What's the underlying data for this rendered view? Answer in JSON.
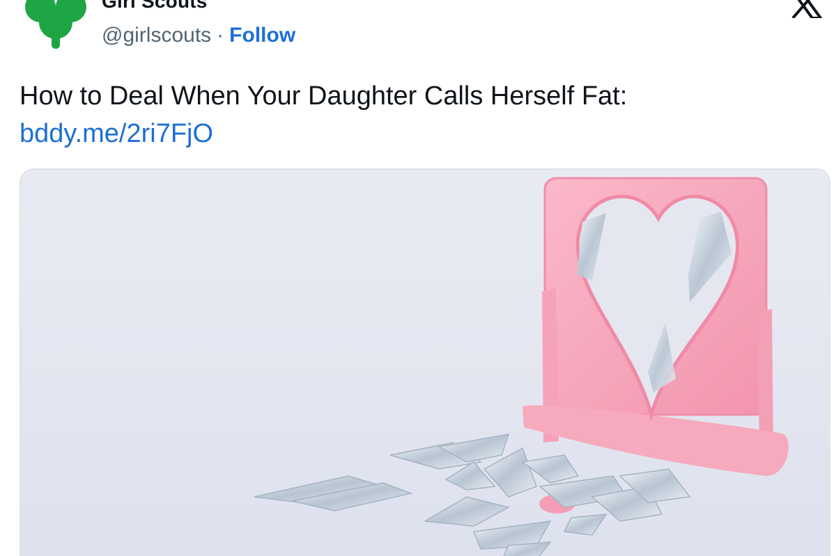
{
  "account": {
    "name": "Girl Scouts",
    "handle": "@girlscouts",
    "separator": "·",
    "follow_label": "Follow"
  },
  "tweet": {
    "text": "How to Deal When Your Daughter Calls Herself Fat:",
    "link": "bddy.me/2ri7FjO"
  },
  "icons": {
    "avatar": "girl-scouts-trefoil-logo",
    "brand": "x-logo"
  },
  "colors": {
    "link": "#1d6fd6",
    "logo_green": "#1ea644",
    "mirror_pink": "#f7a8bd"
  }
}
